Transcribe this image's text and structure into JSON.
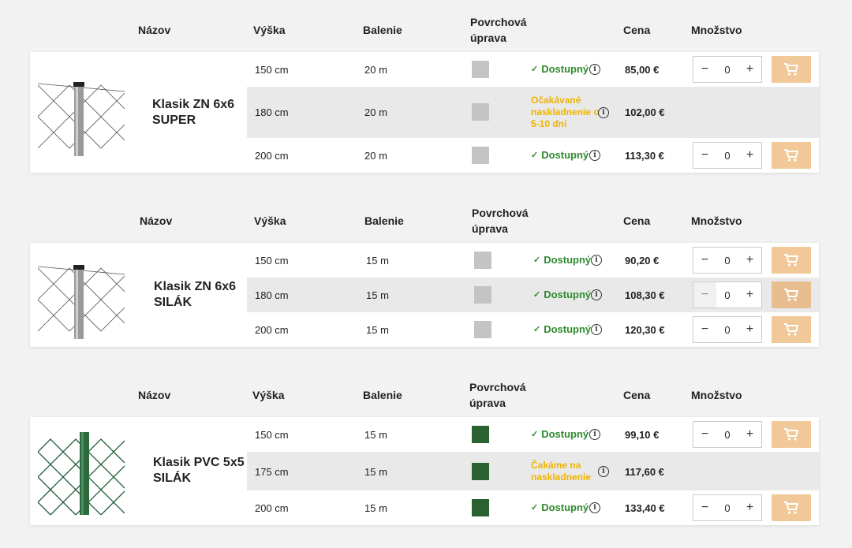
{
  "headers": {
    "name": "Názov",
    "height": "Výška",
    "package": "Balenie",
    "finish": "Povrchová\núprava",
    "price": "Cena",
    "quantity": "Množstvo"
  },
  "icons": {
    "check": "check-icon",
    "info": "info-icon",
    "cart": "cart-icon"
  },
  "colors": {
    "available": "#2e8b2e",
    "waiting": "#f0b400",
    "cart_button": "#f1c998",
    "zinc_swatch": "#c4c4c4",
    "pvc_swatch": "#2a6130"
  },
  "products": [
    {
      "name": "Klasik ZN 6x6 SUPER",
      "variants": [
        {
          "height": "150 cm",
          "package": "20 m",
          "status": "Dostupný",
          "status_type": "available",
          "price": "85,00 €",
          "qty": "0"
        },
        {
          "height": "180 cm",
          "package": "20 m",
          "status": "Očakávané naskladnenie o 5-10 dní",
          "status_type": "waiting",
          "price": "102,00 €",
          "qty": ""
        },
        {
          "height": "200 cm",
          "package": "20 m",
          "status": "Dostupný",
          "status_type": "available",
          "price": "113,30 €",
          "qty": "0"
        }
      ]
    },
    {
      "name": "Klasik ZN 6x6 SILÁK",
      "variants": [
        {
          "height": "150 cm",
          "package": "15 m",
          "status": "Dostupný",
          "status_type": "available",
          "price": "90,20 €",
          "qty": "0"
        },
        {
          "height": "180 cm",
          "package": "15 m",
          "status": "Dostupný",
          "status_type": "available",
          "price": "108,30 €",
          "qty": "0"
        },
        {
          "height": "200 cm",
          "package": "15 m",
          "status": "Dostupný",
          "status_type": "available",
          "price": "120,30 €",
          "qty": "0"
        }
      ]
    },
    {
      "name": "Klasik PVC 5x5 SILÁK",
      "variants": [
        {
          "height": "150 cm",
          "package": "15 m",
          "status": "Dostupný",
          "status_type": "available",
          "price": "99,10 €",
          "qty": "0"
        },
        {
          "height": "175 cm",
          "package": "15 m",
          "status": "Čakáme na naskladnenie",
          "status_type": "waiting",
          "price": "117,60 €",
          "qty": ""
        },
        {
          "height": "200 cm",
          "package": "15 m",
          "status": "Dostupný",
          "status_type": "available",
          "price": "133,40 €",
          "qty": "0"
        }
      ]
    }
  ]
}
